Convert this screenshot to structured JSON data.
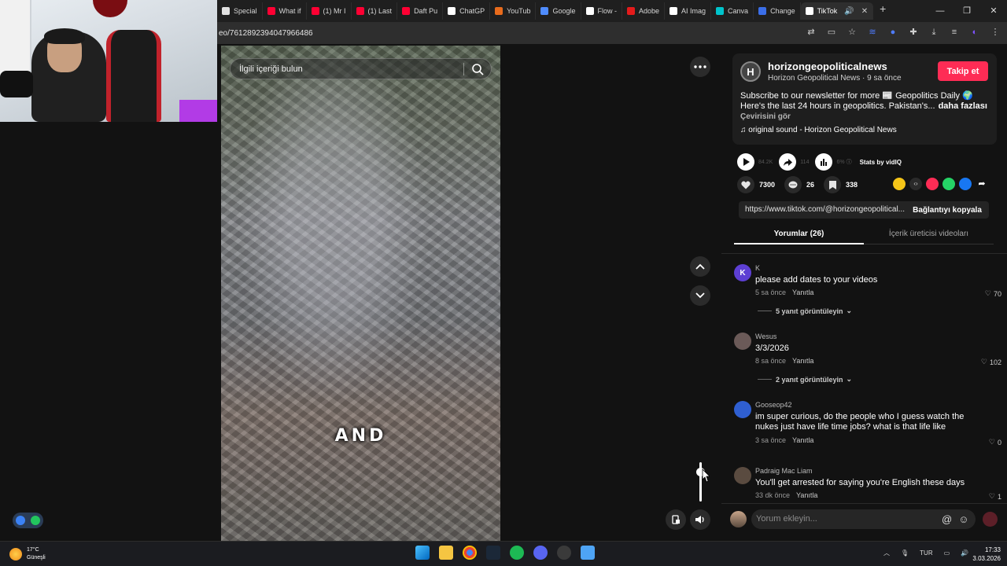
{
  "browser": {
    "tabs": [
      {
        "label": "Special",
        "color": "#e0e0e0"
      },
      {
        "label": "What if",
        "color": "#ff0033"
      },
      {
        "label": "(1) Mr I",
        "color": "#ff0033"
      },
      {
        "label": "(1) Last",
        "color": "#ff0033"
      },
      {
        "label": "Daft Pu",
        "color": "#ff0033"
      },
      {
        "label": "ChatGP",
        "color": "#ffffff"
      },
      {
        "label": "YouTub",
        "color": "#e86b1c"
      },
      {
        "label": "Google",
        "color": "#4f8cff"
      },
      {
        "label": "Flow -",
        "color": "#ffffff"
      },
      {
        "label": "Adobe",
        "color": "#e41b1b"
      },
      {
        "label": "AI Imag",
        "color": "#ffffff"
      },
      {
        "label": "Canva",
        "color": "#00c4cc"
      },
      {
        "label": "Change",
        "color": "#3b6ee8"
      },
      {
        "label": "TikTok",
        "color": "#ffffff"
      }
    ],
    "url": "eo/7612892394047966486"
  },
  "video": {
    "search_placeholder": "İlgili içeriği bulun",
    "caption": "AND"
  },
  "post": {
    "avatar_letter": "H",
    "username": "horizongeopoliticalnews",
    "subtitle": "Horizon Geopolitical News · 9 sa önce",
    "follow_label": "Takip et",
    "desc_line1": "Subscribe to our newsletter for more 📰 Geopolitics Daily 🌍",
    "desc_line2": "Here's the last 24 hours in geopolitics. Pakistan's...",
    "more_label": "daha fazlası",
    "translate_label": "Çevirisini gör",
    "sound": "♫  original sound - Horizon Geopolitical News"
  },
  "stats": {
    "views": "84.2K",
    "shares": "114",
    "engagement": "6%",
    "vidiq_label": "Stats by vidIQ"
  },
  "actions": {
    "likes": "7300",
    "comments": "26",
    "saves": "338"
  },
  "link": {
    "url": "https://www.tiktok.com/@horizongeopolitical...",
    "copy_label": "Bağlantıyı kopyala"
  },
  "tabs": {
    "comments_label": "Yorumlar (26)",
    "creator_label": "İçerik üreticisi videoları"
  },
  "comments": [
    {
      "avatar": "K",
      "avatar_color": "#5d3fd3",
      "name": "K",
      "text": "please add dates to your videos",
      "time": "5 sa önce",
      "reply": "Yanıtla",
      "likes": "70",
      "replies": "5 yanıt görüntüleyin"
    },
    {
      "avatar": "",
      "avatar_color": "#6b5a58",
      "name": "Wesus",
      "text": "3/3/2026",
      "time": "8 sa önce",
      "reply": "Yanıtla",
      "likes": "102",
      "replies": "2 yanıt görüntüleyin"
    },
    {
      "avatar": "",
      "avatar_color": "#2f5fd1",
      "name": "Gooseop42",
      "text": "im super curious, do the people who I guess watch the nukes just have life time jobs? what is that life like",
      "time": "3 sa önce",
      "reply": "Yanıtla",
      "likes": "0",
      "replies": ""
    },
    {
      "avatar": "",
      "avatar_color": "#5a4b40",
      "name": "Padraig Mac Liam",
      "text": "You'll get arrested for saying you're English these days",
      "time": "33 dk önce",
      "reply": "Yanıtla",
      "likes": "1",
      "replies": ""
    }
  ],
  "comment_input": {
    "placeholder": "Yorum ekleyin..."
  },
  "taskbar": {
    "temp": "17°C",
    "weather": "Güneşli",
    "lang": "TUR",
    "time": "17:33",
    "date": "3.03.2026"
  }
}
